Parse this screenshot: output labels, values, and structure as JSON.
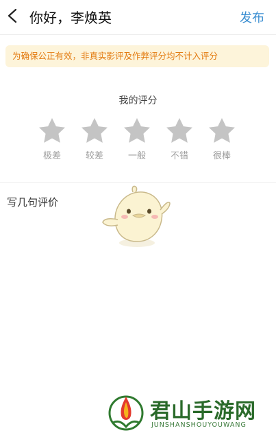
{
  "header": {
    "title": "你好，李焕英",
    "publish_label": "发布"
  },
  "notice": {
    "text": "为确保公正有效，非真实影评及作弊评分均不计入评分"
  },
  "rating": {
    "label": "我的评分",
    "value": 0,
    "max": 5,
    "star_color": "#c4c4c4",
    "options": [
      {
        "label": "极差"
      },
      {
        "label": "较差"
      },
      {
        "label": "一般"
      },
      {
        "label": "不错"
      },
      {
        "label": "很棒"
      }
    ]
  },
  "comment": {
    "placeholder": "写几句评价"
  },
  "watermark": {
    "name": "君山手游网",
    "sub": "JUNSHANSHOUYOUWANG"
  },
  "colors": {
    "accent": "#3a8ed1",
    "notice_bg": "#fdf4da",
    "notice_text": "#e37b11"
  }
}
